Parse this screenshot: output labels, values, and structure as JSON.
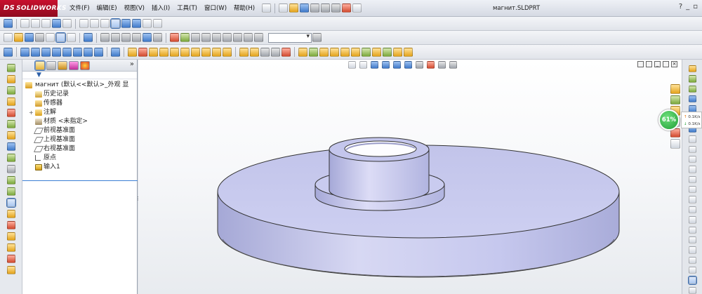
{
  "app": {
    "brand": "SOLIDWORKS",
    "brand_prefix": "DS",
    "document_title": "магнит.SLDPRT",
    "help_label": "?"
  },
  "menus": [
    "文件(F)",
    "编辑(E)",
    "视图(V)",
    "插入(I)",
    "工具(T)",
    "窗口(W)",
    "帮助(H)"
  ],
  "feature_tree": {
    "root": "магнит (默认<<默认>_外观 显",
    "items": [
      {
        "label": "历史记录",
        "icon": "history-icon",
        "expandable": false
      },
      {
        "label": "传感器",
        "icon": "sensor-folder-icon",
        "expandable": false
      },
      {
        "label": "注解",
        "icon": "annotations-icon",
        "expandable": true
      },
      {
        "label": "材质 <未指定>",
        "icon": "material-icon",
        "expandable": false
      },
      {
        "label": "前视基准面",
        "icon": "plane-icon",
        "expandable": false
      },
      {
        "label": "上视基准面",
        "icon": "plane-icon",
        "expandable": false
      },
      {
        "label": "右视基准面",
        "icon": "plane-icon",
        "expandable": false
      },
      {
        "label": "原点",
        "icon": "origin-icon",
        "expandable": false
      },
      {
        "label": "输入1",
        "icon": "imported-body-icon",
        "expandable": false
      }
    ],
    "expand_label": "»"
  },
  "network_widget": {
    "percent": "61%",
    "upload": "0.1K/s",
    "download": "0.1K/s"
  },
  "colors": {
    "brand_red": "#c8102e",
    "model_face": "#c3c5ec",
    "selection_blue": "#3b7ed4",
    "badge_green": "#1f9e36"
  }
}
